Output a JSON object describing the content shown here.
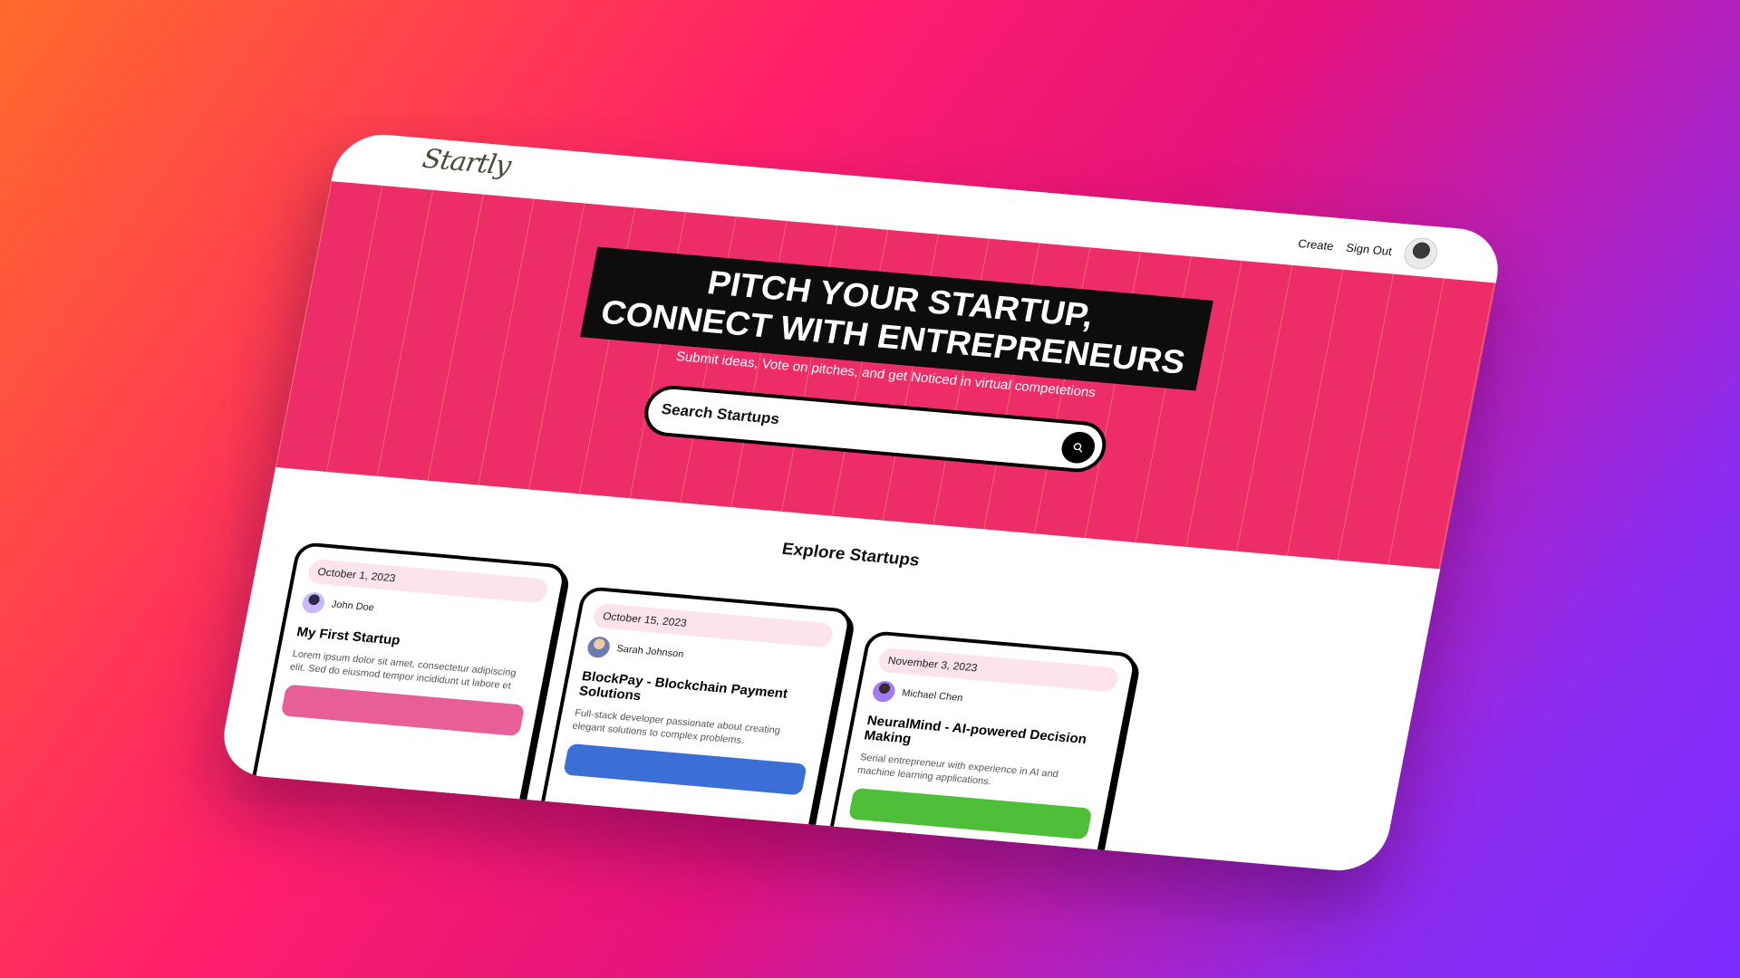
{
  "nav": {
    "logo": "Startly",
    "create_label": "Create",
    "signout_label": "Sign Out"
  },
  "hero": {
    "headline_line1": "PITCH YOUR STARTUP,",
    "headline_line2": "CONNECT WITH ENTREPRENEURS",
    "subtitle": "Submit ideas, Vote on pitches, and get Noticed in virtual competetions",
    "search_placeholder": "Search Startups"
  },
  "section": {
    "title": "Explore Startups"
  },
  "cards": [
    {
      "date": "October 1, 2023",
      "author": "John Doe",
      "title": "My First Startup",
      "description": "Lorem ipsum dolor sit amet, consectetur adipiscing elit. Sed do eiusmod tempor incididunt ut labore et dolore mag...",
      "accent": "#e85f97"
    },
    {
      "date": "October 15, 2023",
      "author": "Sarah Johnson",
      "title": "BlockPay - Blockchain Payment Solutions",
      "description": "Full-stack developer passionate about creating elegant solutions to complex problems.",
      "accent": "#3b6fd6"
    },
    {
      "date": "November 3, 2023",
      "author": "Michael Chen",
      "title": "NeuralMind - AI-powered Decision Making",
      "description": "Serial entrepreneur with experience in AI and machine learning applications.",
      "accent": "#4fbf3a"
    }
  ],
  "colors": {
    "hero_bg": "#ec2d68",
    "headline_bg": "#0d0d0d",
    "date_pill": "#fde3ea"
  }
}
